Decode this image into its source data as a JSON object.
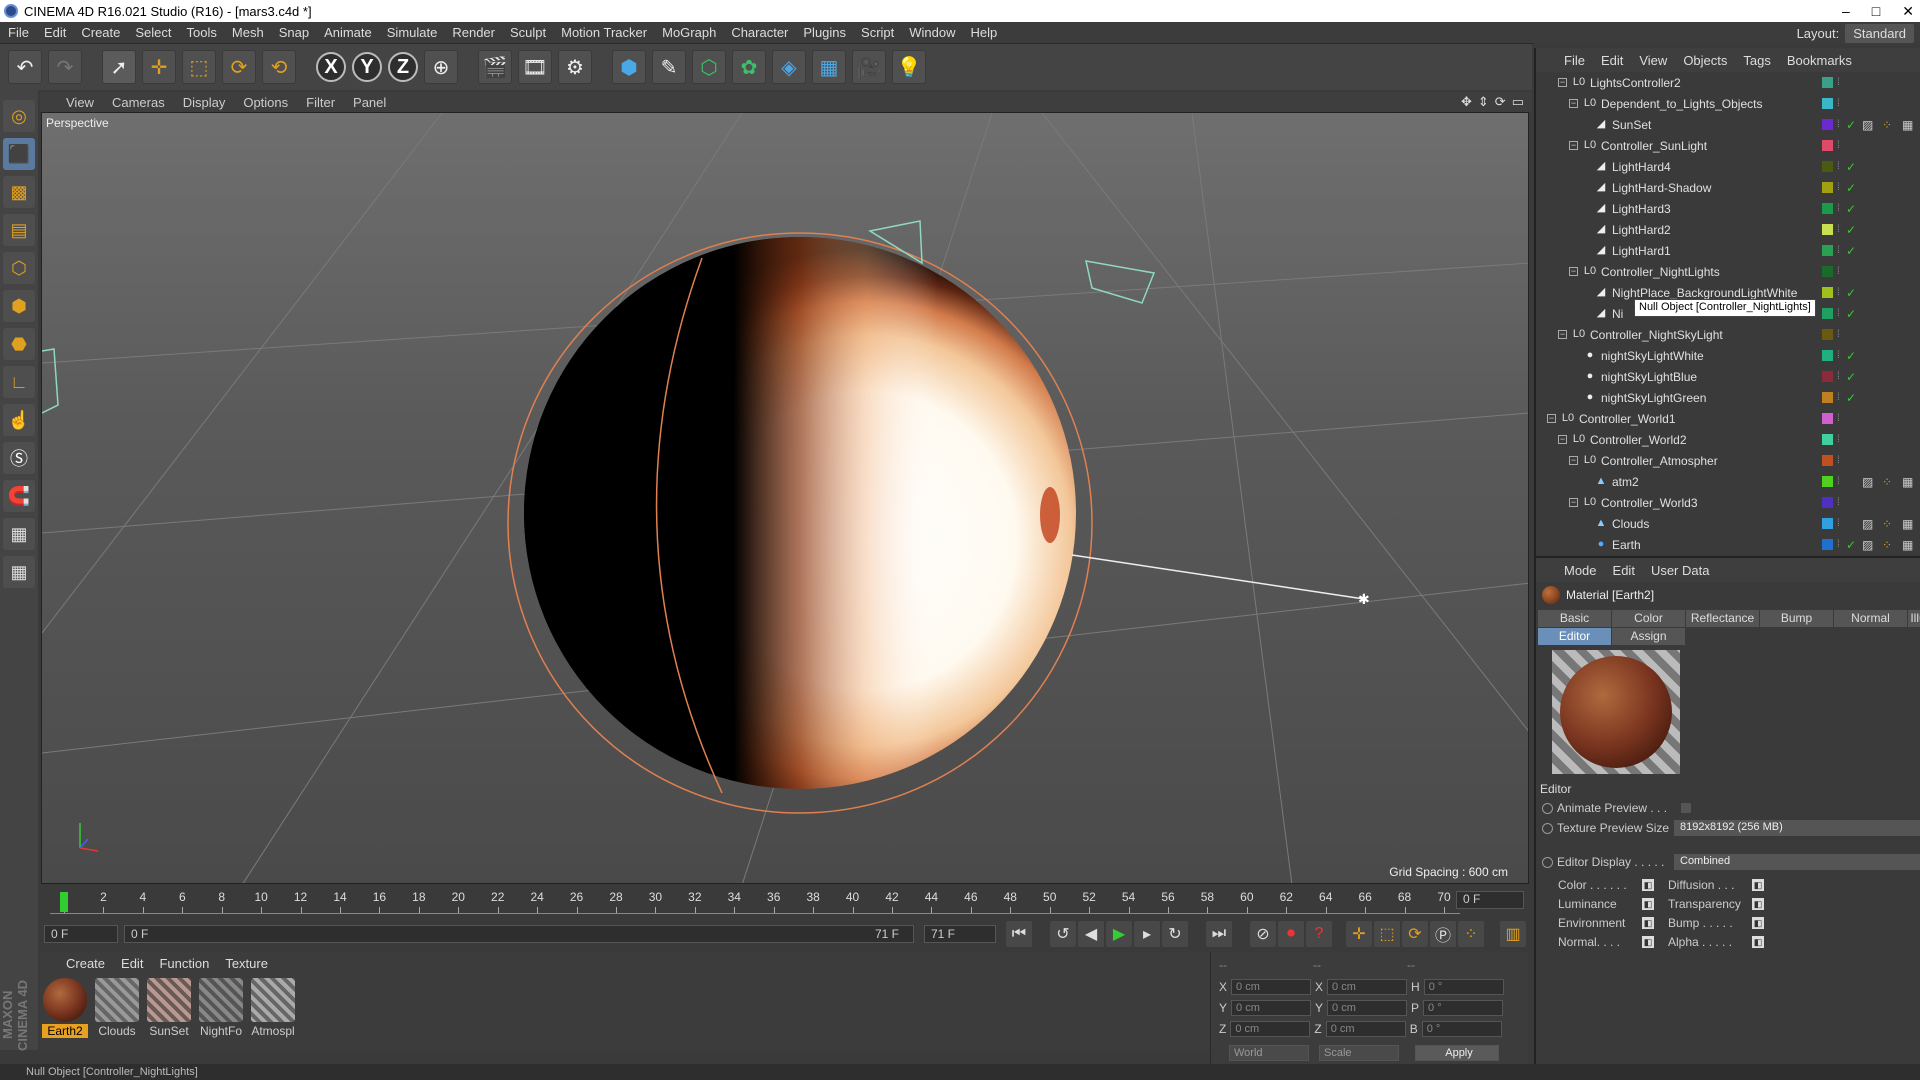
{
  "window": {
    "title": "CINEMA 4D R16.021 Studio (R16) - [mars3.c4d *]",
    "min": "–",
    "max": "□",
    "close": "✕"
  },
  "menu": [
    "File",
    "Edit",
    "Create",
    "Select",
    "Tools",
    "Mesh",
    "Snap",
    "Animate",
    "Simulate",
    "Render",
    "Sculpt",
    "Motion Tracker",
    "MoGraph",
    "Character",
    "Plugins",
    "Script",
    "Window",
    "Help"
  ],
  "layout": {
    "label": "Layout:",
    "value": "Standard"
  },
  "viewport": {
    "menu": [
      "View",
      "Cameras",
      "Display",
      "Options",
      "Filter",
      "Panel"
    ],
    "label": "Perspective",
    "grid_spacing": "Grid Spacing : 600 cm"
  },
  "timeline": {
    "ticks": [
      "0",
      "2",
      "4",
      "6",
      "8",
      "10",
      "12",
      "14",
      "16",
      "18",
      "20",
      "22",
      "24",
      "26",
      "28",
      "30",
      "32",
      "34",
      "36",
      "38",
      "40",
      "42",
      "44",
      "46",
      "48",
      "50",
      "52",
      "54",
      "56",
      "58",
      "60",
      "62",
      "64",
      "66",
      "68",
      "70"
    ],
    "end_field": "0 F"
  },
  "playback": {
    "start": "0 F",
    "range_start": "0 F",
    "range_end": "71 F",
    "end": "71 F"
  },
  "material_manager": {
    "menu": [
      "Create",
      "Edit",
      "Function",
      "Texture"
    ],
    "materials": [
      {
        "label": "Earth2",
        "selected": true
      },
      {
        "label": "Clouds",
        "selected": false
      },
      {
        "label": "SunSet",
        "selected": false
      },
      {
        "label": "NightFo",
        "selected": false
      },
      {
        "label": "Atmospl",
        "selected": false
      }
    ]
  },
  "coordinates": {
    "header": [
      "--",
      "--",
      "--"
    ],
    "rows": [
      {
        "a": "X",
        "av": "0 cm",
        "b": "X",
        "bv": "0 cm",
        "c": "H",
        "cv": "0 °"
      },
      {
        "a": "Y",
        "av": "0 cm",
        "b": "Y",
        "bv": "0 cm",
        "c": "P",
        "cv": "0 °"
      },
      {
        "a": "Z",
        "av": "0 cm",
        "b": "Z",
        "bv": "0 cm",
        "c": "B",
        "cv": "0 °"
      }
    ],
    "world": "World",
    "scale": "Scale",
    "apply": "Apply"
  },
  "object_manager": {
    "menu": [
      "File",
      "Edit",
      "View",
      "Objects",
      "Tags",
      "Bookmarks"
    ],
    "rows": [
      {
        "name": "LightsController2",
        "level": 2,
        "color": "#3aa08a",
        "icon": "null"
      },
      {
        "name": "Dependent_to_Lights_Objects",
        "level": 3,
        "color": "#3ab8c8",
        "icon": "null"
      },
      {
        "name": "SunSet",
        "level": 4,
        "color": "#6a2ad0",
        "icon": "light"
      },
      {
        "name": "Controller_SunLight",
        "level": 3,
        "color": "#e04a6a",
        "icon": "null"
      },
      {
        "name": "LightHard4",
        "level": 4,
        "color": "#4a5a10",
        "icon": "light"
      },
      {
        "name": "LightHard-Shadow",
        "level": 4,
        "color": "#a0a010",
        "icon": "light"
      },
      {
        "name": "LightHard3",
        "level": 4,
        "color": "#1a9a4a",
        "icon": "light"
      },
      {
        "name": "LightHard2",
        "level": 4,
        "color": "#c8e050",
        "icon": "light"
      },
      {
        "name": "LightHard1",
        "level": 4,
        "color": "#2aa050",
        "icon": "light"
      },
      {
        "name": "Controller_NightLights",
        "level": 3,
        "color": "#1a6a2a",
        "icon": "null"
      },
      {
        "name": "NightPlace_BackgroundLightWhite",
        "level": 4,
        "color": "#a0c020",
        "icon": "light"
      },
      {
        "name": "Ni",
        "level": 4,
        "color": "#20a060",
        "icon": "light"
      },
      {
        "name": "Controller_NightSkyLight",
        "level": 2,
        "color": "#6a5a10",
        "icon": "null"
      },
      {
        "name": "nightSkyLightWhite",
        "level": 3,
        "color": "#20b080",
        "icon": "omni"
      },
      {
        "name": "nightSkyLightBlue",
        "level": 3,
        "color": "#8a2a3a",
        "icon": "omni"
      },
      {
        "name": "nightSkyLightGreen",
        "level": 3,
        "color": "#c08020",
        "icon": "omni"
      },
      {
        "name": "Controller_World1",
        "level": 1,
        "color": "#d060d0",
        "icon": "null"
      },
      {
        "name": "Controller_World2",
        "level": 2,
        "color": "#40d0a0",
        "icon": "null"
      },
      {
        "name": "Controller_Atmospher",
        "level": 3,
        "color": "#c05020",
        "icon": "null"
      },
      {
        "name": "atm2",
        "level": 4,
        "color": "#50d020",
        "icon": "obj"
      },
      {
        "name": "Controller_World3",
        "level": 3,
        "color": "#5030c0",
        "icon": "null"
      },
      {
        "name": "Clouds",
        "level": 4,
        "color": "#30a0e0",
        "icon": "obj"
      },
      {
        "name": "Earth",
        "level": 4,
        "color": "#2070d0",
        "icon": "sphere"
      }
    ],
    "tooltip": "Null Object [Controller_NightLights]"
  },
  "attribute_manager": {
    "menu": [
      "Mode",
      "Edit",
      "User Data"
    ],
    "title": "Material [Earth2]",
    "tabs1": [
      "Basic",
      "Color",
      "Reflectance",
      "Bump",
      "Normal",
      "Illu"
    ],
    "tabs2": [
      "Editor",
      "Assign"
    ],
    "section": "Editor",
    "animate_preview": "Animate Preview . . .",
    "texture_preview_size": "Texture Preview Size",
    "texture_preview_value": "8192x8192 (256 MB)",
    "editor_display": "Editor Display . . . . .",
    "editor_display_value": "Combined",
    "channels": [
      {
        "left": "Color . . . . . .",
        "right": "Diffusion . . ."
      },
      {
        "left": "Luminance",
        "right": "Transparency"
      },
      {
        "left": "Environment",
        "right": "Bump . . . . ."
      },
      {
        "left": "Normal. . . .",
        "right": "Alpha . . . . ."
      }
    ]
  },
  "status": "Null Object [Controller_NightLights]"
}
